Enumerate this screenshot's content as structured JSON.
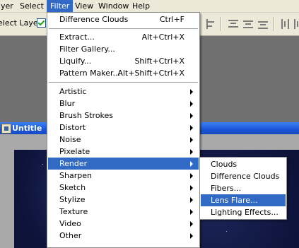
{
  "menubar": {
    "items": [
      {
        "label": "yer"
      },
      {
        "label": "Select"
      },
      {
        "label": "Filter"
      },
      {
        "label": "View"
      },
      {
        "label": "Window"
      },
      {
        "label": "Help"
      }
    ]
  },
  "options": {
    "select_layer_label": "elect Layer"
  },
  "document": {
    "title": "Untitle"
  },
  "filter_menu": {
    "items": [
      {
        "label": "Difference Clouds",
        "shortcut": "Ctrl+F"
      },
      {
        "label": "Extract...",
        "shortcut": "Alt+Ctrl+X"
      },
      {
        "label": "Filter Gallery..."
      },
      {
        "label": "Liquify...",
        "shortcut": "Shift+Ctrl+X"
      },
      {
        "label": "Pattern Maker...",
        "shortcut": "Alt+Shift+Ctrl+X"
      },
      {
        "label": "Artistic"
      },
      {
        "label": "Blur"
      },
      {
        "label": "Brush Strokes"
      },
      {
        "label": "Distort"
      },
      {
        "label": "Noise"
      },
      {
        "label": "Pixelate"
      },
      {
        "label": "Render"
      },
      {
        "label": "Sharpen"
      },
      {
        "label": "Sketch"
      },
      {
        "label": "Stylize"
      },
      {
        "label": "Texture"
      },
      {
        "label": "Video"
      },
      {
        "label": "Other"
      }
    ]
  },
  "render_menu": {
    "items": [
      {
        "label": "Clouds"
      },
      {
        "label": "Difference Clouds"
      },
      {
        "label": "Fibers..."
      },
      {
        "label": "Lens Flare..."
      },
      {
        "label": "Lighting Effects..."
      }
    ]
  }
}
